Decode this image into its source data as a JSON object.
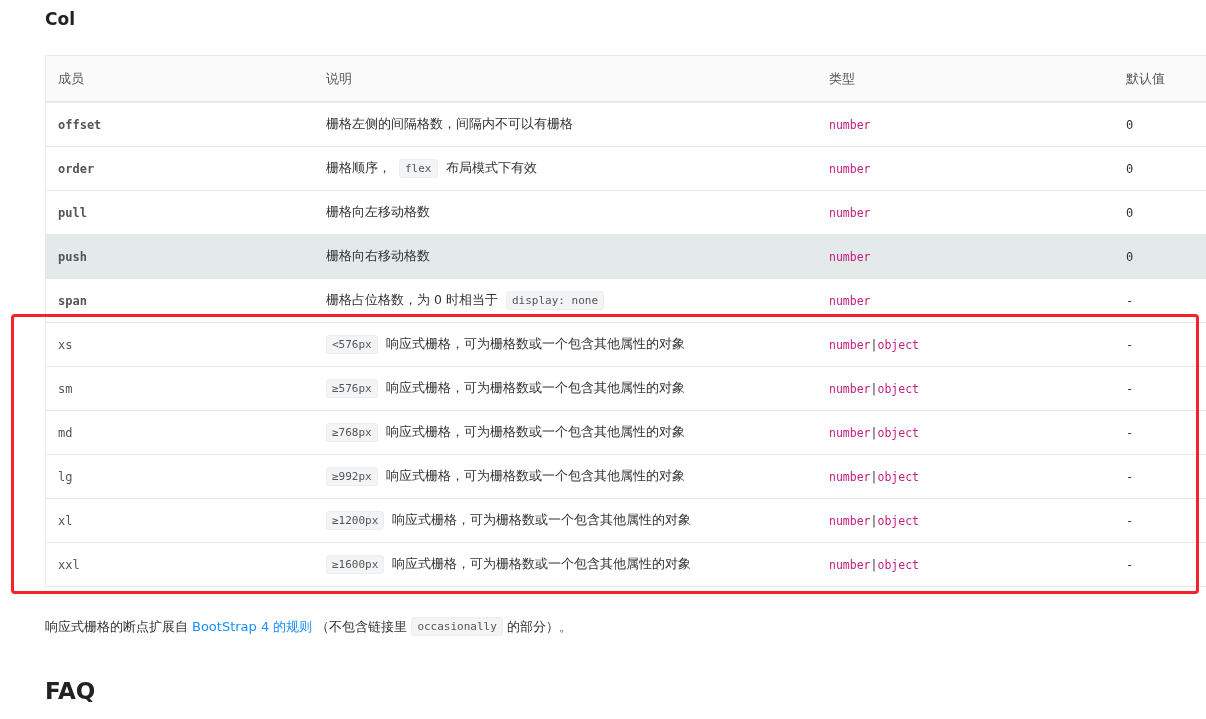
{
  "section_title": "Col",
  "table": {
    "columns": [
      "成员",
      "说明",
      "类型",
      "默认值"
    ],
    "rows": [
      {
        "member": "offset",
        "description": [
          {
            "kind": "text",
            "text": "栅格左侧的间隔格数，间隔内不可以有栅格"
          }
        ],
        "type": [
          "number"
        ],
        "default": "0",
        "hovered": false,
        "highlighted": false
      },
      {
        "member": "order",
        "description": [
          {
            "kind": "text",
            "text": "栅格顺序，"
          },
          {
            "kind": "code",
            "text": "flex"
          },
          {
            "kind": "text",
            "text": "布局模式下有效"
          }
        ],
        "type": [
          "number"
        ],
        "default": "0",
        "hovered": false,
        "highlighted": false
      },
      {
        "member": "pull",
        "description": [
          {
            "kind": "text",
            "text": "栅格向左移动格数"
          }
        ],
        "type": [
          "number"
        ],
        "default": "0",
        "hovered": false,
        "highlighted": false
      },
      {
        "member": "push",
        "description": [
          {
            "kind": "text",
            "text": "栅格向右移动格数"
          }
        ],
        "type": [
          "number"
        ],
        "default": "0",
        "hovered": true,
        "highlighted": false
      },
      {
        "member": "span",
        "description": [
          {
            "kind": "text",
            "text": "栅格占位格数，为 0 时相当于"
          },
          {
            "kind": "code",
            "text": "display: none"
          }
        ],
        "type": [
          "number"
        ],
        "default": "-",
        "hovered": false,
        "highlighted": false
      },
      {
        "member": "xs",
        "description": [
          {
            "kind": "code",
            "text": "<576px"
          },
          {
            "kind": "text",
            "text": "响应式栅格，可为栅格数或一个包含其他属性的对象"
          }
        ],
        "type": [
          "number",
          "|",
          "object"
        ],
        "default": "-",
        "hovered": false,
        "highlighted": true
      },
      {
        "member": "sm",
        "description": [
          {
            "kind": "code",
            "text": "≥576px"
          },
          {
            "kind": "text",
            "text": "响应式栅格，可为栅格数或一个包含其他属性的对象"
          }
        ],
        "type": [
          "number",
          "|",
          "object"
        ],
        "default": "-",
        "hovered": false,
        "highlighted": true
      },
      {
        "member": "md",
        "description": [
          {
            "kind": "code",
            "text": "≥768px"
          },
          {
            "kind": "text",
            "text": "响应式栅格，可为栅格数或一个包含其他属性的对象"
          }
        ],
        "type": [
          "number",
          "|",
          "object"
        ],
        "default": "-",
        "hovered": false,
        "highlighted": true
      },
      {
        "member": "lg",
        "description": [
          {
            "kind": "code",
            "text": "≥992px"
          },
          {
            "kind": "text",
            "text": "响应式栅格，可为栅格数或一个包含其他属性的对象"
          }
        ],
        "type": [
          "number",
          "|",
          "object"
        ],
        "default": "-",
        "hovered": false,
        "highlighted": true
      },
      {
        "member": "xl",
        "description": [
          {
            "kind": "code",
            "text": "≥1200px"
          },
          {
            "kind": "text",
            "text": "响应式栅格，可为栅格数或一个包含其他属性的对象"
          }
        ],
        "type": [
          "number",
          "|",
          "object"
        ],
        "default": "-",
        "hovered": false,
        "highlighted": true
      },
      {
        "member": "xxl",
        "description": [
          {
            "kind": "code",
            "text": "≥1600px"
          },
          {
            "kind": "text",
            "text": "响应式栅格，可为栅格数或一个包含其他属性的对象"
          }
        ],
        "type": [
          "number",
          "|",
          "object"
        ],
        "default": "-",
        "hovered": false,
        "highlighted": true
      }
    ]
  },
  "note": [
    {
      "kind": "text",
      "text": "响应式栅格的断点扩展自"
    },
    {
      "kind": "link",
      "text": "BootStrap 4 的规则"
    },
    {
      "kind": "text",
      "text": "（不包含链接里"
    },
    {
      "kind": "code",
      "text": "occasionally"
    },
    {
      "kind": "text",
      "text": "的部分）。"
    }
  ],
  "faq_title": "FAQ"
}
